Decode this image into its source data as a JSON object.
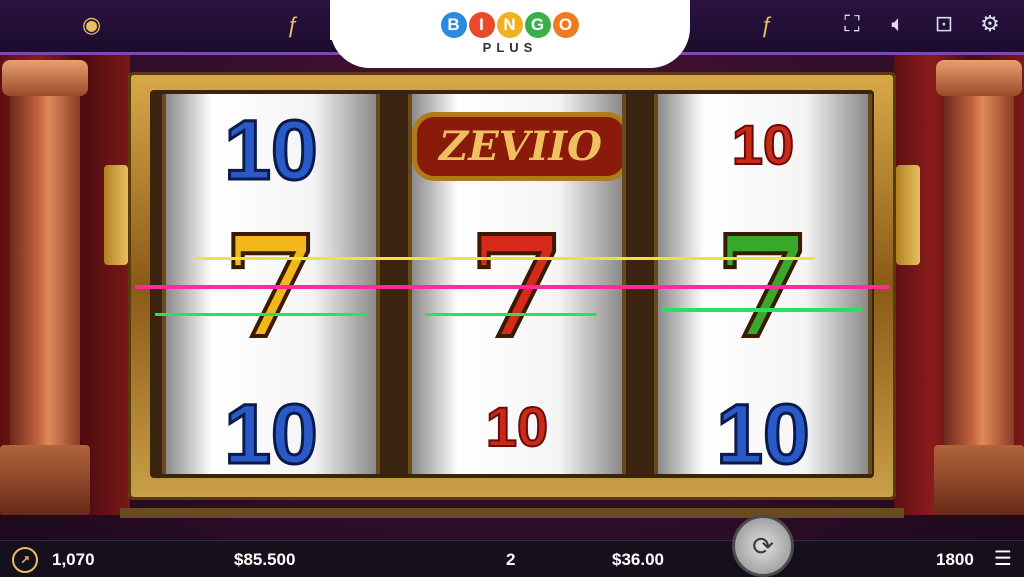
{
  "logo": {
    "letters": [
      "B",
      "I",
      "N",
      "G",
      "O"
    ],
    "sub": "PLUS"
  },
  "top_left_icons": {
    "coin": "coin-icon",
    "f_glyph": "ƒ"
  },
  "top_right_f": "ƒ",
  "toolbar": {
    "fullscreen": "fullscreen-icon",
    "sound": "speaker-icon",
    "camera": "camera-rotate-icon",
    "settings": "gear-icon"
  },
  "reels": [
    {
      "top": "10",
      "middle": "7",
      "middle_color": "#f2b81a",
      "bottom": "10"
    },
    {
      "top": "ZEVIIO",
      "middle": "7",
      "middle_color": "#d82a1a",
      "bottom": "10"
    },
    {
      "top": "10",
      "middle": "7",
      "middle_color": "#3aa82a",
      "bottom": "10"
    }
  ],
  "paylines": [
    {
      "color": "#f0e040"
    },
    {
      "color": "#ff2aa0"
    },
    {
      "color": "#2ae060"
    }
  ],
  "status": {
    "balance_icon": "gauge-icon",
    "credits": "1,070",
    "balance": "$85.500",
    "lines": "2",
    "bet": "$36.00",
    "win": "1800",
    "menu_icon": "menu-icon"
  },
  "spin_icon": "spin-icon"
}
